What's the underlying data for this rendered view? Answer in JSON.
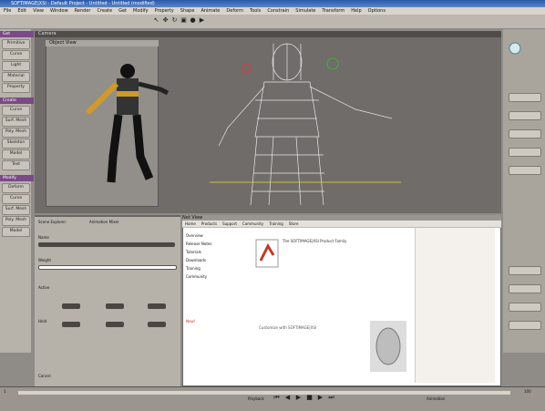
{
  "window": {
    "title": "SOFTIMAGE|XSI - Default Project - Untitled - Untitled (modified)"
  },
  "menu": [
    "File",
    "Edit",
    "View",
    "Window",
    "Render",
    "Create",
    "Get",
    "Modify",
    "Property",
    "Shape",
    "Animate",
    "Deform",
    "Tools",
    "Constrain",
    "Simulate",
    "Transform",
    "Help",
    "Options"
  ],
  "left_tabs": {
    "header_get": "Get",
    "get_items": [
      "Primitive",
      "Curve",
      "Light",
      "Material",
      "Property"
    ],
    "header_create": "Create",
    "create_items": [
      "Curve",
      "Surf. Mesh",
      "Poly. Mesh",
      "Skeleton",
      "Model",
      "Text"
    ],
    "header_modify": "Modify",
    "modify_items": [
      "Deform",
      "Curve",
      "Surf. Mesh",
      "Poly. Mesh",
      "Model"
    ]
  },
  "viewport": {
    "label": "Camera",
    "inner_label": "Object View"
  },
  "lower_panel": {
    "tabs": [
      "Scene Explorer",
      "Animation Mixer"
    ],
    "rows": [
      "Name",
      "Weight",
      "Active",
      "Hold"
    ],
    "footer": "Cancel"
  },
  "dialog": {
    "title": "Net View",
    "nav": [
      "Home",
      "Products",
      "Support",
      "Community",
      "Training",
      "Store"
    ],
    "side_links": [
      "Overview",
      "Release Notes",
      "Tutorials",
      "Downloads",
      "Training",
      "Community"
    ],
    "heading": "The SOFTIMAGE|XSI Product Family",
    "promo": "Customize with SOFTIMAGE|XSI",
    "highlight": "New!"
  },
  "timeline": {
    "frame_start": "1",
    "frame_end": "100",
    "playback_label": "Playback",
    "animation_label": "Animation"
  },
  "colors": {
    "titlebar": "#2a5aa8",
    "tab_header": "#7a4a86",
    "viewport_bg": "#6f6c69",
    "accent_red": "#c23a2a"
  }
}
